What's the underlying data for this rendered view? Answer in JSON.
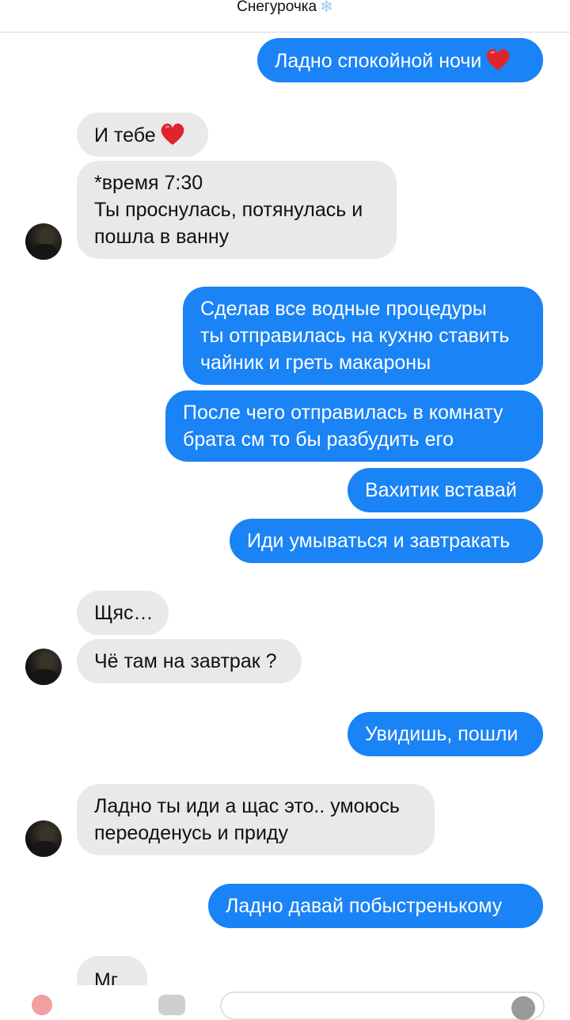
{
  "header": {
    "title": "Снегурочка",
    "icon": "snowflake-icon"
  },
  "messages": [
    {
      "dir": "out",
      "lines": [
        "Ладно спокойной ночи"
      ],
      "emoji": "heart"
    },
    {
      "dir": "in",
      "lines": [
        "И тебе"
      ],
      "emoji": "heart"
    },
    {
      "dir": "in",
      "lines": [
        "*время 7:30",
        "Ты проснулась, потянулась и",
        "пошла в ванну"
      ]
    },
    {
      "dir": "out",
      "lines": [
        "Сделав все водные процедуры",
        "ты отправилась на кухню ставить",
        "чайник и греть макароны"
      ]
    },
    {
      "dir": "out",
      "lines": [
        "После чего отправилась в комнату",
        "брата см то бы разбудить его"
      ]
    },
    {
      "dir": "out",
      "lines": [
        "Вахитик вставай"
      ]
    },
    {
      "dir": "out",
      "lines": [
        "Иди умываться и завтракать"
      ]
    },
    {
      "dir": "in",
      "lines": [
        "Щяс…"
      ]
    },
    {
      "dir": "in",
      "lines": [
        "Чё там на завтрак ?"
      ]
    },
    {
      "dir": "out",
      "lines": [
        "Увидишь, пошли"
      ]
    },
    {
      "dir": "in",
      "lines": [
        "Ладно ты иди а щас это.. умоюсь",
        "переоденусь и приду"
      ]
    },
    {
      "dir": "out",
      "lines": [
        "Ладно давай побыстренькому"
      ]
    },
    {
      "dir": "in",
      "lines": [
        "Мг"
      ]
    }
  ],
  "colors": {
    "outgoing": "#1a83f5",
    "incoming": "#e9e9eb",
    "heart": "#e0242c"
  }
}
